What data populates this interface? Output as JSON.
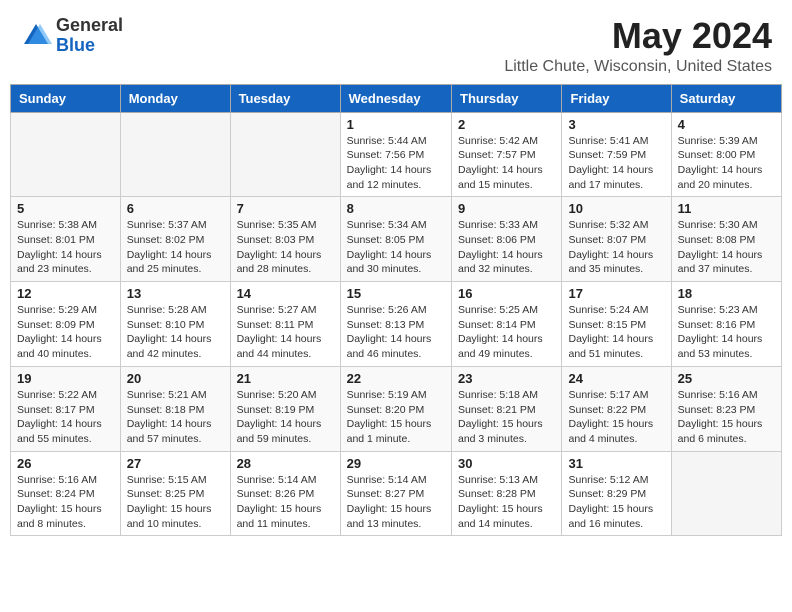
{
  "header": {
    "logo_general": "General",
    "logo_blue": "Blue",
    "month_title": "May 2024",
    "location": "Little Chute, Wisconsin, United States"
  },
  "weekdays": [
    "Sunday",
    "Monday",
    "Tuesday",
    "Wednesday",
    "Thursday",
    "Friday",
    "Saturday"
  ],
  "weeks": [
    [
      {
        "num": "",
        "info": ""
      },
      {
        "num": "",
        "info": ""
      },
      {
        "num": "",
        "info": ""
      },
      {
        "num": "1",
        "info": "Sunrise: 5:44 AM\nSunset: 7:56 PM\nDaylight: 14 hours\nand 12 minutes."
      },
      {
        "num": "2",
        "info": "Sunrise: 5:42 AM\nSunset: 7:57 PM\nDaylight: 14 hours\nand 15 minutes."
      },
      {
        "num": "3",
        "info": "Sunrise: 5:41 AM\nSunset: 7:59 PM\nDaylight: 14 hours\nand 17 minutes."
      },
      {
        "num": "4",
        "info": "Sunrise: 5:39 AM\nSunset: 8:00 PM\nDaylight: 14 hours\nand 20 minutes."
      }
    ],
    [
      {
        "num": "5",
        "info": "Sunrise: 5:38 AM\nSunset: 8:01 PM\nDaylight: 14 hours\nand 23 minutes."
      },
      {
        "num": "6",
        "info": "Sunrise: 5:37 AM\nSunset: 8:02 PM\nDaylight: 14 hours\nand 25 minutes."
      },
      {
        "num": "7",
        "info": "Sunrise: 5:35 AM\nSunset: 8:03 PM\nDaylight: 14 hours\nand 28 minutes."
      },
      {
        "num": "8",
        "info": "Sunrise: 5:34 AM\nSunset: 8:05 PM\nDaylight: 14 hours\nand 30 minutes."
      },
      {
        "num": "9",
        "info": "Sunrise: 5:33 AM\nSunset: 8:06 PM\nDaylight: 14 hours\nand 32 minutes."
      },
      {
        "num": "10",
        "info": "Sunrise: 5:32 AM\nSunset: 8:07 PM\nDaylight: 14 hours\nand 35 minutes."
      },
      {
        "num": "11",
        "info": "Sunrise: 5:30 AM\nSunset: 8:08 PM\nDaylight: 14 hours\nand 37 minutes."
      }
    ],
    [
      {
        "num": "12",
        "info": "Sunrise: 5:29 AM\nSunset: 8:09 PM\nDaylight: 14 hours\nand 40 minutes."
      },
      {
        "num": "13",
        "info": "Sunrise: 5:28 AM\nSunset: 8:10 PM\nDaylight: 14 hours\nand 42 minutes."
      },
      {
        "num": "14",
        "info": "Sunrise: 5:27 AM\nSunset: 8:11 PM\nDaylight: 14 hours\nand 44 minutes."
      },
      {
        "num": "15",
        "info": "Sunrise: 5:26 AM\nSunset: 8:13 PM\nDaylight: 14 hours\nand 46 minutes."
      },
      {
        "num": "16",
        "info": "Sunrise: 5:25 AM\nSunset: 8:14 PM\nDaylight: 14 hours\nand 49 minutes."
      },
      {
        "num": "17",
        "info": "Sunrise: 5:24 AM\nSunset: 8:15 PM\nDaylight: 14 hours\nand 51 minutes."
      },
      {
        "num": "18",
        "info": "Sunrise: 5:23 AM\nSunset: 8:16 PM\nDaylight: 14 hours\nand 53 minutes."
      }
    ],
    [
      {
        "num": "19",
        "info": "Sunrise: 5:22 AM\nSunset: 8:17 PM\nDaylight: 14 hours\nand 55 minutes."
      },
      {
        "num": "20",
        "info": "Sunrise: 5:21 AM\nSunset: 8:18 PM\nDaylight: 14 hours\nand 57 minutes."
      },
      {
        "num": "21",
        "info": "Sunrise: 5:20 AM\nSunset: 8:19 PM\nDaylight: 14 hours\nand 59 minutes."
      },
      {
        "num": "22",
        "info": "Sunrise: 5:19 AM\nSunset: 8:20 PM\nDaylight: 15 hours\nand 1 minute."
      },
      {
        "num": "23",
        "info": "Sunrise: 5:18 AM\nSunset: 8:21 PM\nDaylight: 15 hours\nand 3 minutes."
      },
      {
        "num": "24",
        "info": "Sunrise: 5:17 AM\nSunset: 8:22 PM\nDaylight: 15 hours\nand 4 minutes."
      },
      {
        "num": "25",
        "info": "Sunrise: 5:16 AM\nSunset: 8:23 PM\nDaylight: 15 hours\nand 6 minutes."
      }
    ],
    [
      {
        "num": "26",
        "info": "Sunrise: 5:16 AM\nSunset: 8:24 PM\nDaylight: 15 hours\nand 8 minutes."
      },
      {
        "num": "27",
        "info": "Sunrise: 5:15 AM\nSunset: 8:25 PM\nDaylight: 15 hours\nand 10 minutes."
      },
      {
        "num": "28",
        "info": "Sunrise: 5:14 AM\nSunset: 8:26 PM\nDaylight: 15 hours\nand 11 minutes."
      },
      {
        "num": "29",
        "info": "Sunrise: 5:14 AM\nSunset: 8:27 PM\nDaylight: 15 hours\nand 13 minutes."
      },
      {
        "num": "30",
        "info": "Sunrise: 5:13 AM\nSunset: 8:28 PM\nDaylight: 15 hours\nand 14 minutes."
      },
      {
        "num": "31",
        "info": "Sunrise: 5:12 AM\nSunset: 8:29 PM\nDaylight: 15 hours\nand 16 minutes."
      },
      {
        "num": "",
        "info": ""
      }
    ]
  ]
}
